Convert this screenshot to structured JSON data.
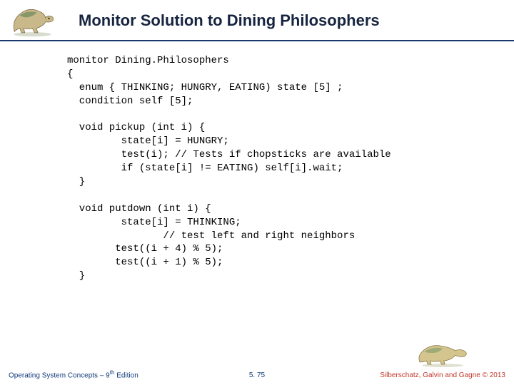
{
  "header": {
    "title": "Monitor Solution to Dining Philosophers"
  },
  "code": {
    "line1": "monitor Dining.Philosophers",
    "line2": "{",
    "line3": "  enum { THINKING; HUNGRY, EATING) state [5] ;",
    "line4": "  condition self [5];",
    "line5": "",
    "line6": "  void pickup (int i) {",
    "line7": "         state[i] = HUNGRY;",
    "line8": "         test(i); // Tests if chopsticks are available",
    "line9": "         if (state[i] != EATING) self[i].wait;",
    "line10": "  }",
    "line11": "",
    "line12": "  void putdown (int i) {",
    "line13": "         state[i] = THINKING;",
    "line14": "                // test left and right neighbors",
    "line15": "        test((i + 4) % 5);",
    "line16": "        test((i + 1) % 5);",
    "line17": "  }"
  },
  "footer": {
    "left_prefix": "Operating System Concepts – 9",
    "left_sup": "th",
    "left_suffix": " Edition",
    "center": "5. 75",
    "right": "Silberschatz, Galvin and Gagne © 2013"
  }
}
